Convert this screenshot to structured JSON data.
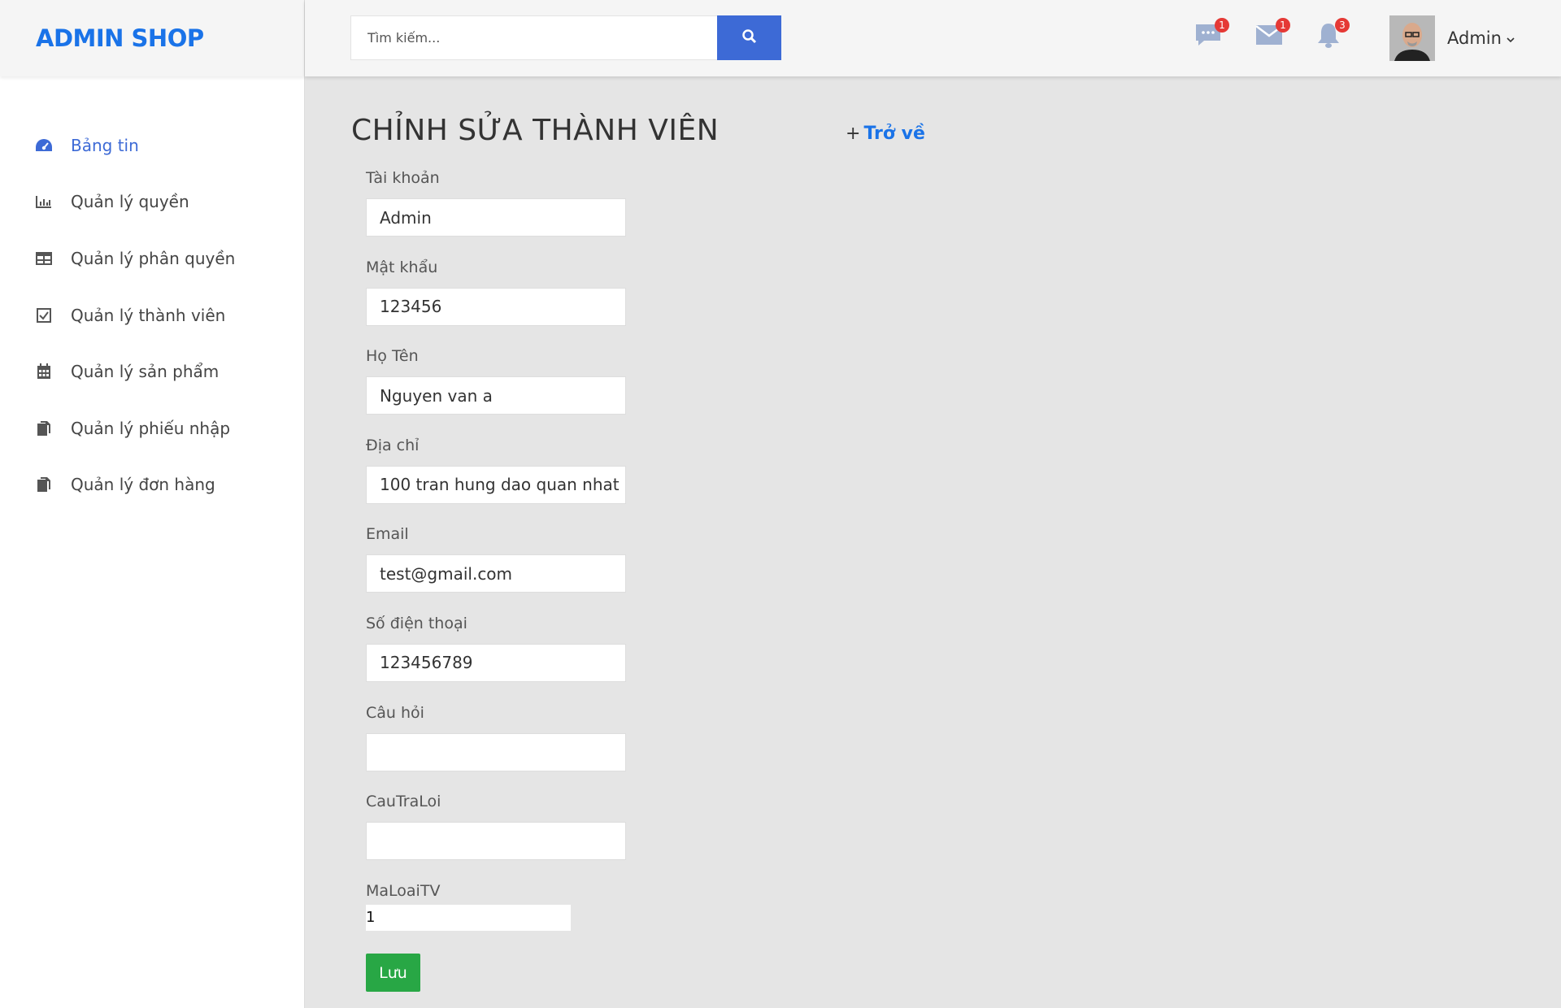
{
  "brand": {
    "logo": "ADMIN SHOP"
  },
  "sidebar": {
    "items": [
      {
        "label": "Bảng tin",
        "icon": "dashboard-icon",
        "active": true
      },
      {
        "label": "Quản lý quyền",
        "icon": "bar-chart-icon"
      },
      {
        "label": "Quản lý phân quyền",
        "icon": "table-icon"
      },
      {
        "label": "Quản lý thành viên",
        "icon": "checkbox-icon"
      },
      {
        "label": "Quản lý sản phẩm",
        "icon": "calendar-icon"
      },
      {
        "label": "Quản lý phiếu nhập",
        "icon": "documents-icon"
      },
      {
        "label": "Quản lý đơn hàng",
        "icon": "documents-icon"
      }
    ]
  },
  "header": {
    "search": {
      "placeholder": "Tìm kiếm..."
    },
    "notifications": {
      "messages": {
        "icon": "chat-icon",
        "count": "1"
      },
      "mail": {
        "icon": "mail-icon",
        "count": "1"
      },
      "alerts": {
        "icon": "bell-icon",
        "count": "3"
      }
    },
    "user": {
      "name": "Admin"
    }
  },
  "page": {
    "title": "CHỈNH SỬA THÀNH VIÊN",
    "back_label": "Trở về",
    "back_plus": "+"
  },
  "form": {
    "fields": [
      {
        "label": "Tài khoản",
        "value": "Admin"
      },
      {
        "label": "Mật khẩu",
        "value": "123456"
      },
      {
        "label": "Họ Tên",
        "value": "Nguyen van a"
      },
      {
        "label": "Địa chỉ",
        "value": "100 tran hung dao quan nhat"
      },
      {
        "label": "Email",
        "value": "test@gmail.com"
      },
      {
        "label": "Số điện thoại",
        "value": "123456789"
      },
      {
        "label": "Câu hỏi",
        "value": ""
      },
      {
        "label": "CauTraLoi",
        "value": ""
      }
    ],
    "maloai": {
      "label": "MaLoaiTV",
      "value": "1"
    },
    "save_label": "Lưu"
  },
  "colors": {
    "brand": "#1a73e8",
    "primary": "#3d6ad6",
    "success": "#28a745",
    "badge": "#e53935"
  }
}
